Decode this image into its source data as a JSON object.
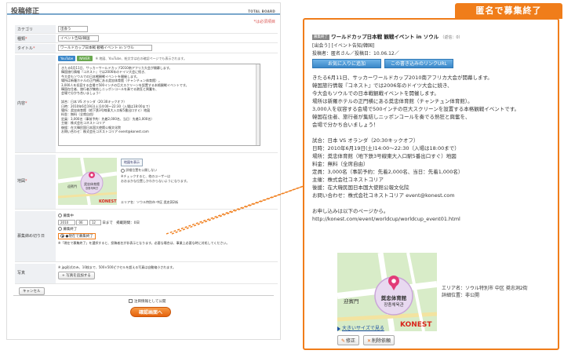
{
  "form": {
    "title": "投稿修正",
    "brand": "TOTAL BOARD",
    "required_note": "*は必須項目",
    "category": {
      "label": "カテゴリ",
      "value": "出会う"
    },
    "type": {
      "label": "種類",
      "value": "イベント告知/韓国"
    },
    "title_field": {
      "label": "タイトル",
      "value": "ワールドカップ日本戦 観戦イベント in ソウル"
    },
    "content": {
      "label": "内容",
      "youtube_label": "YouTube",
      "naver_label": "NAVER",
      "hint": "※ 地図、YouTube、絵文字は右の確認ページでも表示されます。",
      "lines": [
        "きたる6月11日、サッカーワールドカップ2010南アフリカ大会が開幕します。",
        "韓国旅行情報『コネスト』では2006年のドイツ大会に続き、",
        "今大会もソウルでの日本戦観戦イベントを開催します。",
        "場所は新羅ホテルの正門横にある奨忠体育館（チャンチュン体育館）。",
        "3,000人を収容する会場で500インチの巨大スクリーンを設置する本格観戦イベントです。",
        "韓国在住者、旅行者が集結しニッポンコールを奏でる熱狂と興奮を、",
        "会場で分かち合いましょう！",
        "",
        "試合：日本 VS オランダ（20:30キックオフ）",
        "日時：2010年6月19日(土)14:00〜22:30（入場は18:00まで）",
        "場所：奨忠体育館（地下鉄3号線東大入口駅5番出口すぐ）地図",
        "料金：無料（全席自由）",
        "定員：3,000名（事前予約：先着2,000名、当日：先着1,000名）",
        "主催：株式会社コネストコリア",
        "後援：在大韓民国日本国大使館公報文化院",
        "お問い合わせ：株式会社コネストコリア event@konest.com"
      ]
    },
    "map": {
      "label": "地図",
      "show_button": "地図を表示",
      "checkbox_text": "詳細位置を公開しない",
      "note": "※チェックすると、他のユーザーは\nおおまかな位置しかわからないようになります。",
      "area": "エリア名：ソウル特別市 中区 奨忠洞2街"
    },
    "recruit": {
      "label": "募集締め切り日",
      "option_open": "募集中",
      "year": "2010",
      "month": "06",
      "day": "12",
      "day_suffix": "日まで",
      "remaining": "掲載期間：0日",
      "option_renew": "募集終了",
      "option_ended": "●現在で募集終了",
      "note": "※「現在で募集終了」を選択すると、投稿者名が非表示となります。必要な場合は、事業上必要な時に対処してください。"
    },
    "photo": {
      "label": "写真",
      "note": "※ jpg形式のみ、10枚まで、500×500ピクセルを超える写真は自動縮小されます。",
      "add_button": "+ 写真を追加する"
    },
    "cancel_button": "キャンセル",
    "no_comment_label": "注目情報として公開",
    "confirm_button": "確認画面へ"
  },
  "preview": {
    "tab_label": "匿名で募集終了",
    "badge": "募集終了",
    "title": "ワールドカップ日本戦 観戦イベント in ソウル",
    "replies": "（返信：0）",
    "category": "[出会う] [イベント告知/韓国]",
    "meta": "投稿者：匿名さん／投稿日：10.06.12／",
    "fav_button": "お気に入りに追加",
    "link_button": "この書き込みのリンクURL",
    "body": [
      "きたる6月11日、サッカーワールドカップ2010南アフリカ大会が開幕します。",
      "韓国旅行情報『コネスト』では2006年のドイツ大会に続き、",
      "今大会もソウルでの日本戦観戦イベントを開催します。",
      "場所は新羅ホテルの正門横にある奨忠体育館（チャンチュン体育館）。",
      "3,000人を収容する会場で500インチの巨大スクリーンを設置する本格観戦イベントです。",
      "韓国在住者、旅行者が集結しニッポンコールを奏でる熱狂と興奮を、",
      "会場で分かち合いましょう！",
      "",
      "試合：日本 VS オランダ（20:30キックオフ）",
      "日時：2010年6月19日(土)14:00〜22:30（入場は18:00まで）",
      "場所：奨忠体育館（地下鉄3号線東大入口駅5番出口すぐ）地図",
      "料金：無料（全席自由）",
      "定員：3,000名（事前予約：先着2,000名、当日：先着1,000名）",
      "主催：株式会社コネストコリア",
      "後援：在大韓民国日本国大使館公報文化院",
      "お問い合わせ：株式会社コネストコリア event@konest.com",
      "",
      "お申し込みは以下のページから。",
      "http://konest.com/event/worldcup/worldcup_event01.html"
    ],
    "map_area": "エリア名：ソウル特別市 中区 奨忠洞2街",
    "map_detail": "詳細位置：非公開",
    "map_link": "大きいサイズで見る",
    "map_labels": {
      "gate": "迎賓門",
      "venue_jp": "奨忠体育館",
      "venue_kr": "장충체육관",
      "logo": "KONEST"
    },
    "edit_button": "修正",
    "delete_button": "削除依頼"
  },
  "colors": {
    "accent_orange": "#f07d1a",
    "button_blue": "#3b88c9",
    "link_blue": "#1a4fa0"
  }
}
